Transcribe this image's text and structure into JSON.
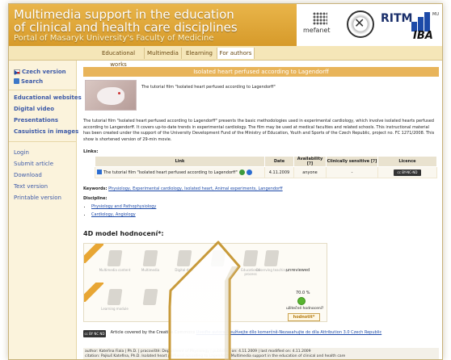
{
  "header": {
    "line1": "Multimedia support in the education",
    "line2": "of clinical and health care disciplines",
    "line3": "Portal of Masaryk University's Faculty of Medicine",
    "logos": {
      "mefanet": "mefanet",
      "ritm": "RITM",
      "iba": "IBA",
      "mu": "MU"
    }
  },
  "topnav": {
    "tabs": [
      "Educational works",
      "Multimedia",
      "Elearning",
      "For authors"
    ]
  },
  "sidebar": {
    "items": [
      {
        "label": "Czech version",
        "icon": "czech-flag-icon"
      },
      {
        "label": "Search",
        "icon": "search-icon"
      },
      {
        "label": "Educational websites"
      },
      {
        "label": "Digital video"
      },
      {
        "label": "Presentations"
      },
      {
        "label": "Casuistics in images"
      },
      {
        "label": "Login"
      },
      {
        "label": "Submit article"
      },
      {
        "label": "Download"
      },
      {
        "label": "Text version"
      },
      {
        "label": "Printable version"
      }
    ]
  },
  "main": {
    "title": "Isolated heart perfused according to Lagendorff",
    "thumb_caption": "The tutorial film \"Isolated heart perfused according to Lagendorff\"",
    "description": "The tutorial film \"Isolated heart perfused according to Lagendorff\" presents the basic methodologies used in experimental cardiology, which involve isolated hearts perfused according to Langendorff. It covers up-to-date trends in experimental cardiology. The film may be used at medical faculties and related schools. This instructional material has been created under the support of the University Development Fund of the Ministry of Education, Youth and Sports of the Czech Republic, project no. FC 1271/2008. This show is shortened version of 29-min movie.",
    "links_label": "Links:",
    "links_table": {
      "headers": [
        "Link",
        "Date",
        "Availability [?]",
        "Clinically sensitive [?]",
        "Licence"
      ],
      "rows": [
        [
          "The tutorial film \"Isolated heart perfused according to Lagendorff\"",
          "4.11.2009",
          "anyone",
          "-",
          ""
        ]
      ]
    },
    "keywords_label": "Keywords:",
    "keywords": "Physiology, Experimental cardiology, Isolated heart, Animal experiments, Langendorff",
    "discipline_label": "Discipline:",
    "disciplines": [
      "Physiology and Pathophysiology",
      "Cardiology, Angiology"
    ],
    "model_title": "4D model hodnocení*:",
    "rating_cells": [
      "Multimedia content",
      "Multimedia",
      "Digital data",
      "",
      "Educational process",
      "Observing teaching",
      "Learning module",
      "",
      "",
      "",
      "",
      ""
    ],
    "unreviewed": "unreviewed",
    "percent": "70.0 %",
    "useful_question": "užitečné hodnocení?",
    "rate_button": "hodnotit*",
    "license_text": "Article covered by the Creative Commons",
    "license_link": "Uveďte autora-Neužívejte dílo komerčně-Nezasahujte do díla Attribution 3.0 Czech Republic",
    "authors": "author: Kateřina Fiala | Ph.D. | pracoviště: Department of Physiology | published on: 4.11.2009 | last modified on: 4.11.2009",
    "citation": "citation: Pajkuš Katefina, Ph.D. Isolated heart perfused according to Lagendorff. Multimedia support in the education of clinical and health care"
  },
  "colors": {
    "header_bg": "#e0a53a",
    "title_bar": "#e8b45a",
    "link": "#1d4aa8",
    "ok": "#58b52f"
  }
}
